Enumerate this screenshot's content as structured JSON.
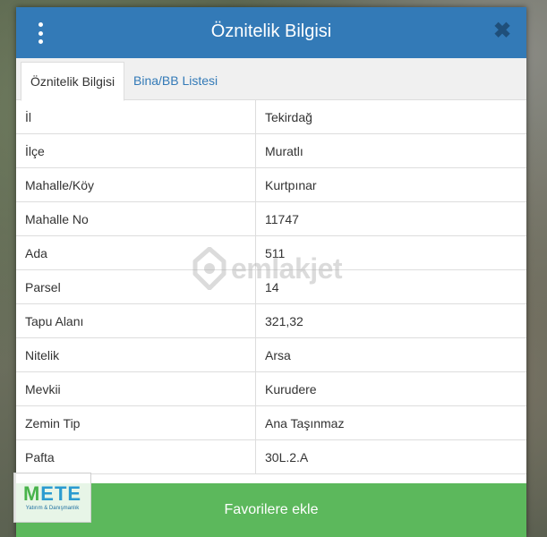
{
  "header": {
    "title": "Öznitelik Bilgisi",
    "menu_icon": "vertical-dots-icon",
    "close_icon": "close-icon",
    "close_glyph": "✖"
  },
  "tabs": [
    {
      "label": "Öznitelik Bilgisi",
      "active": true
    },
    {
      "label": "Bina/BB Listesi",
      "active": false
    }
  ],
  "attributes": [
    {
      "key": "İl",
      "value": "Tekirdağ"
    },
    {
      "key": "İlçe",
      "value": "Muratlı"
    },
    {
      "key": "Mahalle/Köy",
      "value": "Kurtpınar"
    },
    {
      "key": "Mahalle No",
      "value": "11747"
    },
    {
      "key": "Ada",
      "value": "511"
    },
    {
      "key": "Parsel",
      "value": "14"
    },
    {
      "key": "Tapu Alanı",
      "value": "321,32"
    },
    {
      "key": "Nitelik",
      "value": "Arsa"
    },
    {
      "key": "Mevkii",
      "value": "Kurudere"
    },
    {
      "key": "Zemin Tip",
      "value": "Ana Taşınmaz"
    },
    {
      "key": "Pafta",
      "value": "30L.2.A"
    }
  ],
  "watermark": {
    "text": "emlakjet"
  },
  "favorite_button": {
    "label": "Favorilere ekle"
  },
  "logo": {
    "text_m": "M",
    "text_rest": "ETE",
    "subtitle": "Yatırım & Danışmanlık"
  },
  "colors": {
    "header": "#337ab7",
    "tab_link": "#337ab7",
    "button": "#5cb85c"
  }
}
